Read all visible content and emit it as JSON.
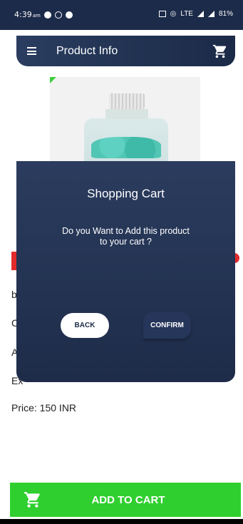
{
  "status_bar": {
    "time": "4:39",
    "ampm": "am",
    "network": "LTE",
    "battery": "81%"
  },
  "app_bar": {
    "title": "Product Info",
    "menu_icon": "hamburger-menu-icon",
    "cart_icon": "shopping-cart-icon"
  },
  "product": {
    "image_alt": "bottle of green crystals",
    "partial_lines": [
      "b",
      "C",
      "A",
      "Ex"
    ],
    "price": "Price: 150 INR"
  },
  "dialog": {
    "title": "Shopping Cart",
    "message": "Do you Want to Add this product to your cart ?",
    "back_label": "BACK",
    "confirm_label": "CONFIRM"
  },
  "footer": {
    "add_to_cart_label": "ADD TO CART",
    "icon": "shopping-cart-icon"
  },
  "colors": {
    "primary_navy": "#1e2c49",
    "accent_green": "#2fcf2f",
    "tag_red": "#e22b2b"
  }
}
